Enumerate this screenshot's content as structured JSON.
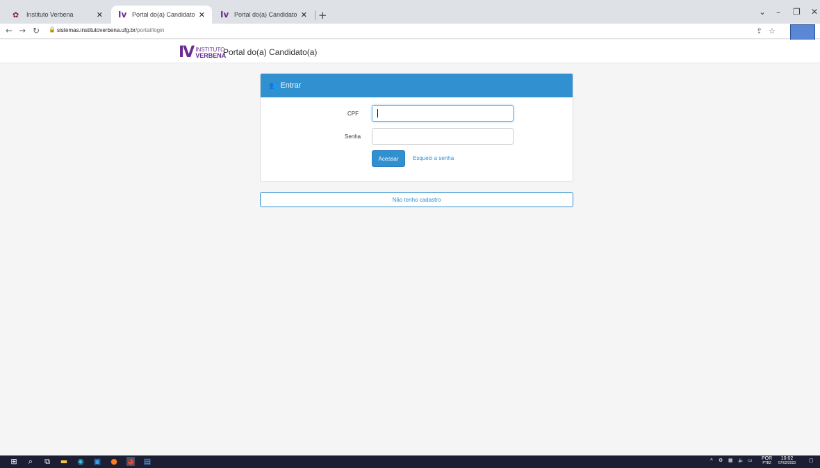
{
  "browser": {
    "tabs": [
      {
        "title": "Instituto Verbena",
        "active": false
      },
      {
        "title": "Portal do(a) Candidato(a)",
        "active": true
      },
      {
        "title": "Portal do(a) Candidato(a)",
        "active": false
      }
    ],
    "url_host": "sistemas.institutoverbena.ufg.br",
    "url_path": "/portal/login"
  },
  "header": {
    "logo_mark": "IV",
    "logo_line1": "INSTITUTO",
    "logo_line2": "VERBENA",
    "title": "Portal do(a) Candidato(a)"
  },
  "login": {
    "heading": "Entrar",
    "cpf_label": "CPF",
    "cpf_value": "",
    "password_label": "Senha",
    "password_value": "",
    "submit_label": "Acessar",
    "forgot_label": "Esqueci a senha"
  },
  "register_label": "Não tenho cadastro",
  "taskbar": {
    "lang_line1": "POR",
    "lang_line2": "PTB2",
    "time": "10:02",
    "date": "07/02/2023"
  },
  "colors": {
    "primary": "#3090d0",
    "brand_purple": "#6a2c91",
    "taskbar": "#1c1f33"
  }
}
